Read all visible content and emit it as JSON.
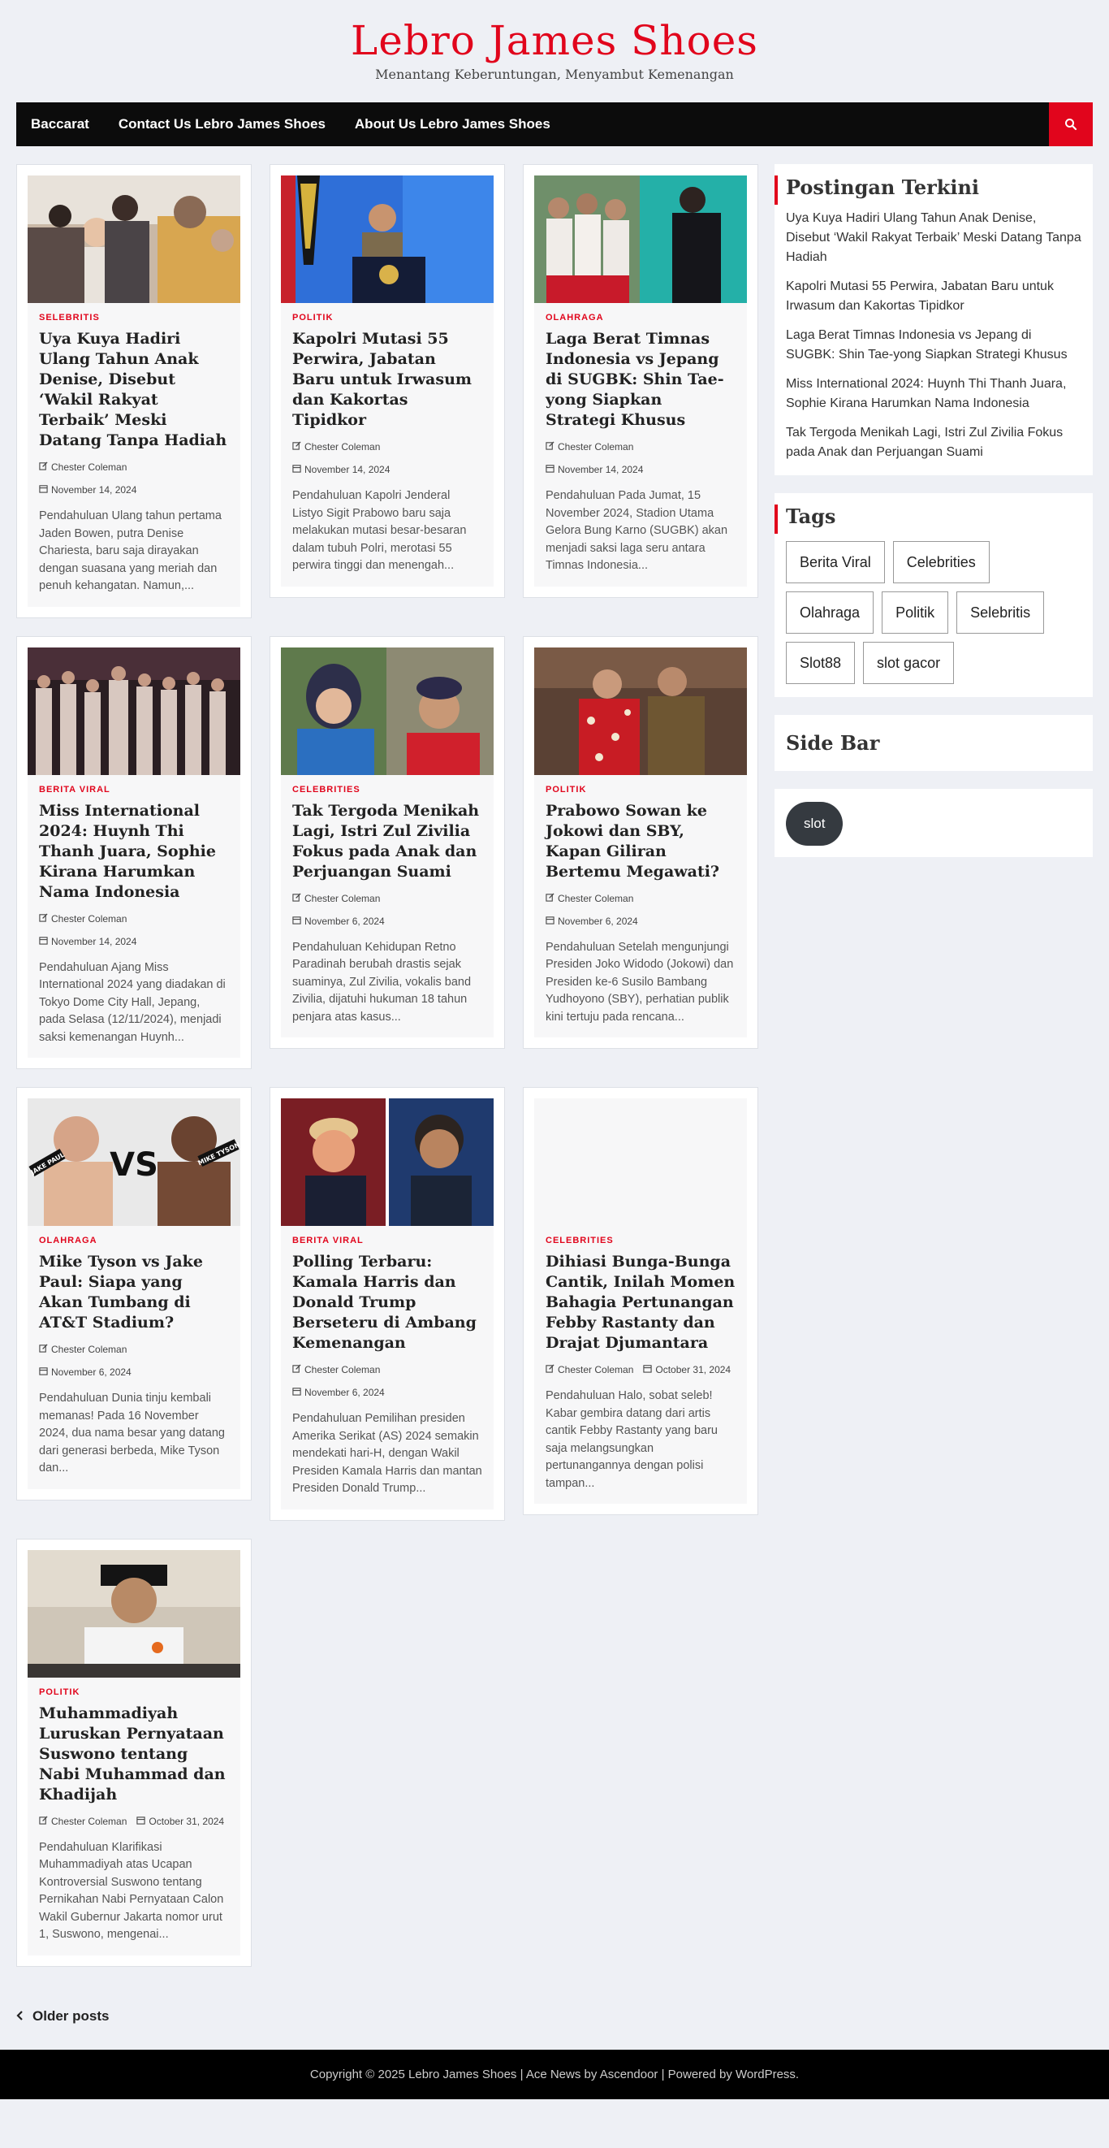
{
  "site": {
    "title": "Lebro James Shoes",
    "tagline": "Menantang Keberuntungan, Menyambut Kemenangan"
  },
  "nav": {
    "items": [
      "Baccarat",
      "Contact Us Lebro James Shoes",
      "About Us Lebro James Shoes"
    ],
    "search_icon": "search-icon"
  },
  "posts": [
    {
      "category": "SELEBRITIS",
      "title": "Uya Kuya Hadiri Ulang Tahun Anak Denise, Disebut ‘Wakil Rakyat Terbaik’ Meski Datang Tanpa Hadiah",
      "author": "Chester Coleman",
      "date": "November 14, 2024",
      "excerpt": "Pendahuluan Ulang tahun pertama Jaden Bowen, putra Denise Chariesta, baru saja dirayakan dengan suasana yang meriah dan penuh kehangatan. Namun,..."
    },
    {
      "category": "POLITIK",
      "title": "Kapolri Mutasi 55 Perwira, Jabatan Baru untuk Irwasum dan Kakortas Tipidkor",
      "author": "Chester Coleman",
      "date": "November 14, 2024",
      "excerpt": "Pendahuluan Kapolri Jenderal Listyo Sigit Prabowo baru saja melakukan mutasi besar-besaran dalam tubuh Polri, merotasi 55 perwira tinggi dan menengah..."
    },
    {
      "category": "OLAHRAGA",
      "title": "Laga Berat Timnas Indonesia vs Jepang di SUGBK: Shin Tae-yong Siapkan Strategi Khusus",
      "author": "Chester Coleman",
      "date": "November 14, 2024",
      "excerpt": "Pendahuluan Pada Jumat, 15 November 2024, Stadion Utama Gelora Bung Karno (SUGBK) akan menjadi saksi laga seru antara Timnas Indonesia..."
    },
    {
      "category": "BERITA VIRAL",
      "title": "Miss International 2024: Huynh Thi Thanh Juara, Sophie Kirana Harumkan Nama Indonesia",
      "author": "Chester Coleman",
      "date": "November 14, 2024",
      "excerpt": "Pendahuluan Ajang Miss International 2024 yang diadakan di Tokyo Dome City Hall, Jepang, pada Selasa (12/11/2024), menjadi saksi kemenangan Huynh..."
    },
    {
      "category": "CELEBRITIES",
      "title": "Tak Tergoda Menikah Lagi, Istri Zul Zivilia Fokus pada Anak dan Perjuangan Suami",
      "author": "Chester Coleman",
      "date": "November 6, 2024",
      "excerpt": "Pendahuluan Kehidupan Retno Paradinah berubah drastis sejak suaminya, Zul Zivilia, vokalis band Zivilia, dijatuhi hukuman 18 tahun penjara atas kasus..."
    },
    {
      "category": "POLITIK",
      "title": "Prabowo Sowan ke Jokowi dan SBY, Kapan Giliran Bertemu Megawati?",
      "author": "Chester Coleman",
      "date": "November 6, 2024",
      "excerpt": "Pendahuluan Setelah mengunjungi Presiden Joko Widodo (Jokowi) dan Presiden ke-6 Susilo Bambang Yudhoyono (SBY), perhatian publik kini tertuju pada rencana..."
    },
    {
      "category": "OLAHRAGA",
      "title": "Mike Tyson vs Jake Paul: Siapa yang Akan Tumbang di AT&T Stadium?",
      "author": "Chester Coleman",
      "date": "November 6, 2024",
      "excerpt": "Pendahuluan Dunia tinju kembali memanas! Pada 16 November 2024, dua nama besar yang datang dari generasi berbeda, Mike Tyson dan...",
      "thumb_labels": [
        "JAKE PAUL",
        "VS",
        "MIKE TYSON"
      ]
    },
    {
      "category": "BERITA VIRAL",
      "title": "Polling Terbaru: Kamala Harris dan Donald Trump Berseteru di Ambang Kemenangan",
      "author": "Chester Coleman",
      "date": "November 6, 2024",
      "excerpt": "Pendahuluan Pemilihan presiden Amerika Serikat (AS) 2024 semakin mendekati hari-H, dengan Wakil Presiden Kamala Harris dan mantan Presiden Donald Trump..."
    },
    {
      "category": "CELEBRITIES",
      "title": "Dihiasi Bunga-Bunga Cantik, Inilah Momen Bahagia Pertunangan Febby Rastanty dan Drajat Djumantara",
      "author": "Chester Coleman",
      "date": "October 31, 2024",
      "excerpt": "Pendahuluan Halo, sobat seleb! Kabar gembira datang dari artis cantik Febby Rastanty yang baru saja melangsungkan pertunangannya dengan polisi tampan..."
    },
    {
      "category": "POLITIK",
      "title": "Muhammadiyah Luruskan Pernyataan Suswono tentang Nabi Muhammad dan Khadijah",
      "author": "Chester Coleman",
      "date": "October 31, 2024",
      "excerpt": "Pendahuluan Klarifikasi Muhammadiyah atas Ucapan Kontroversial Suswono tentang Pernikahan Nabi Pernyataan Calon Wakil Gubernur Jakarta nomor urut 1, Suswono, mengenai..."
    }
  ],
  "sidebar": {
    "recent_title": "Postingan Terkini",
    "recent": [
      "Uya Kuya Hadiri Ulang Tahun Anak Denise, Disebut ‘Wakil Rakyat Terbaik’ Meski Datang Tanpa Hadiah",
      "Kapolri Mutasi 55 Perwira, Jabatan Baru untuk Irwasum dan Kakortas Tipidkor",
      "Laga Berat Timnas Indonesia vs Jepang di SUGBK: Shin Tae-yong Siapkan Strategi Khusus",
      "Miss International 2024: Huynh Thi Thanh Juara, Sophie Kirana Harumkan Nama Indonesia",
      "Tak Tergoda Menikah Lagi, Istri Zul Zivilia Fokus pada Anak dan Perjuangan Suami"
    ],
    "tags_title": "Tags",
    "tags": [
      "Berita Viral",
      "Celebrities",
      "Olahraga",
      "Politik",
      "Selebritis",
      "Slot88",
      "slot gacor"
    ],
    "sidebar_title": "Side Bar",
    "slot_label": "slot"
  },
  "pagination": {
    "older": "Older posts"
  },
  "footer": {
    "text": "Copyright © 2025 Lebro James Shoes | Ace News by Ascendoor | Powered by WordPress."
  },
  "colors": {
    "accent": "#e1051c",
    "nav_bg": "#0c0c0c",
    "page_bg": "#eef0f5"
  }
}
